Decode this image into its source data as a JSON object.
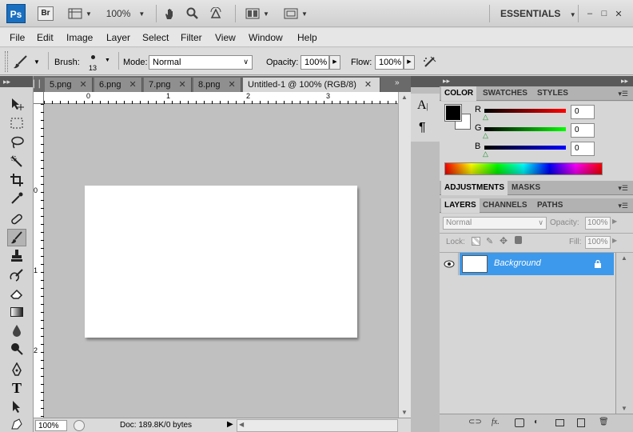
{
  "app": {
    "logo": "Ps",
    "bridge": "Br",
    "zoom": "100%",
    "workspace": "ESSENTIALS",
    "window_buttons": [
      "–",
      "□",
      "✕"
    ]
  },
  "menu": [
    "File",
    "Edit",
    "Image",
    "Layer",
    "Select",
    "Filter",
    "View",
    "Window",
    "Help"
  ],
  "options": {
    "brush_label": "Brush:",
    "brush_size": "13",
    "mode_label": "Mode:",
    "mode_value": "Normal",
    "opacity_label": "Opacity:",
    "opacity_value": "100%",
    "flow_label": "Flow:",
    "flow_value": "100%"
  },
  "tabs": [
    {
      "label": "5.png"
    },
    {
      "label": "6.png"
    },
    {
      "label": "7.png"
    },
    {
      "label": "8.png"
    },
    {
      "label": "Untitled-1 @ 100% (RGB/8)"
    }
  ],
  "ruler": {
    "h_labels": [
      "0",
      "1",
      "2",
      "3"
    ],
    "v_labels": [
      "0",
      "1",
      "2"
    ]
  },
  "status": {
    "zoom": "100%",
    "doc": "Doc: 189.8K/0 bytes"
  },
  "panels": {
    "color_tabs": [
      "COLOR",
      "SWATCHES",
      "STYLES"
    ],
    "rgb": [
      {
        "label": "R",
        "value": "0"
      },
      {
        "label": "G",
        "value": "0"
      },
      {
        "label": "B",
        "value": "0"
      }
    ],
    "adjust_tabs": [
      "ADJUSTMENTS",
      "MASKS"
    ],
    "layer_tabs": [
      "LAYERS",
      "CHANNELS",
      "PATHS"
    ],
    "blend_mode": "Normal",
    "opacity_label": "Opacity:",
    "opacity_value": "100%",
    "lock_label": "Lock:",
    "fill_label": "Fill:",
    "fill_value": "100%",
    "layer_name": "Background"
  },
  "colors": {
    "selected_layer": "#3d99ec",
    "tab_active": "#d8d8d8"
  }
}
